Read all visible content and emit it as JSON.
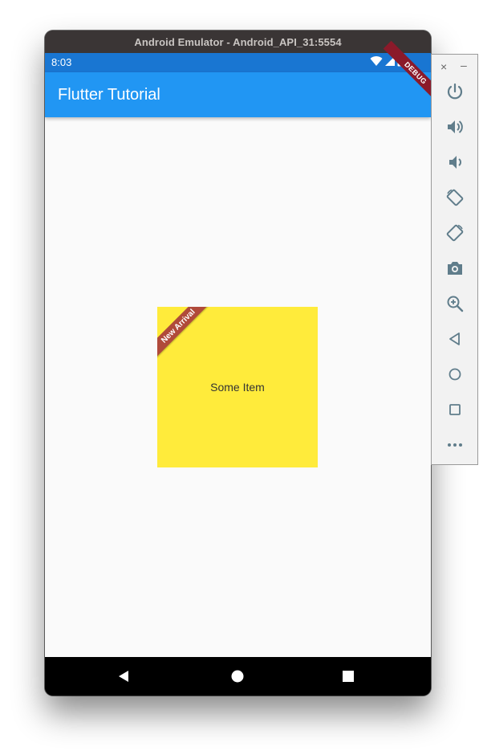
{
  "window": {
    "title": "Android Emulator - Android_API_31:5554"
  },
  "status_bar": {
    "time": "8:03",
    "icons": [
      "wifi-icon",
      "cell-signal-icon",
      "battery-icon"
    ]
  },
  "debug_banner": "DEBUG",
  "app_bar": {
    "title": "Flutter Tutorial"
  },
  "card": {
    "label": "Some Item",
    "banner": "New Arrival"
  },
  "nav_bar": {
    "buttons": [
      "back-icon",
      "home-icon",
      "recents-icon"
    ]
  },
  "side_panel": {
    "close_label": "×",
    "minimize_label": "–",
    "tools": [
      "power-icon",
      "volume-up-icon",
      "volume-down-icon",
      "rotate-left-icon",
      "rotate-right-icon",
      "camera-icon",
      "zoom-icon",
      "back-icon",
      "home-icon",
      "overview-icon",
      "more-icon"
    ]
  },
  "colors": {
    "app_bar": "#2196f3",
    "status_bar": "#1976d2",
    "card": "#ffeb3b",
    "banner": "#b04a3a",
    "debug": "#8b1a2a"
  }
}
